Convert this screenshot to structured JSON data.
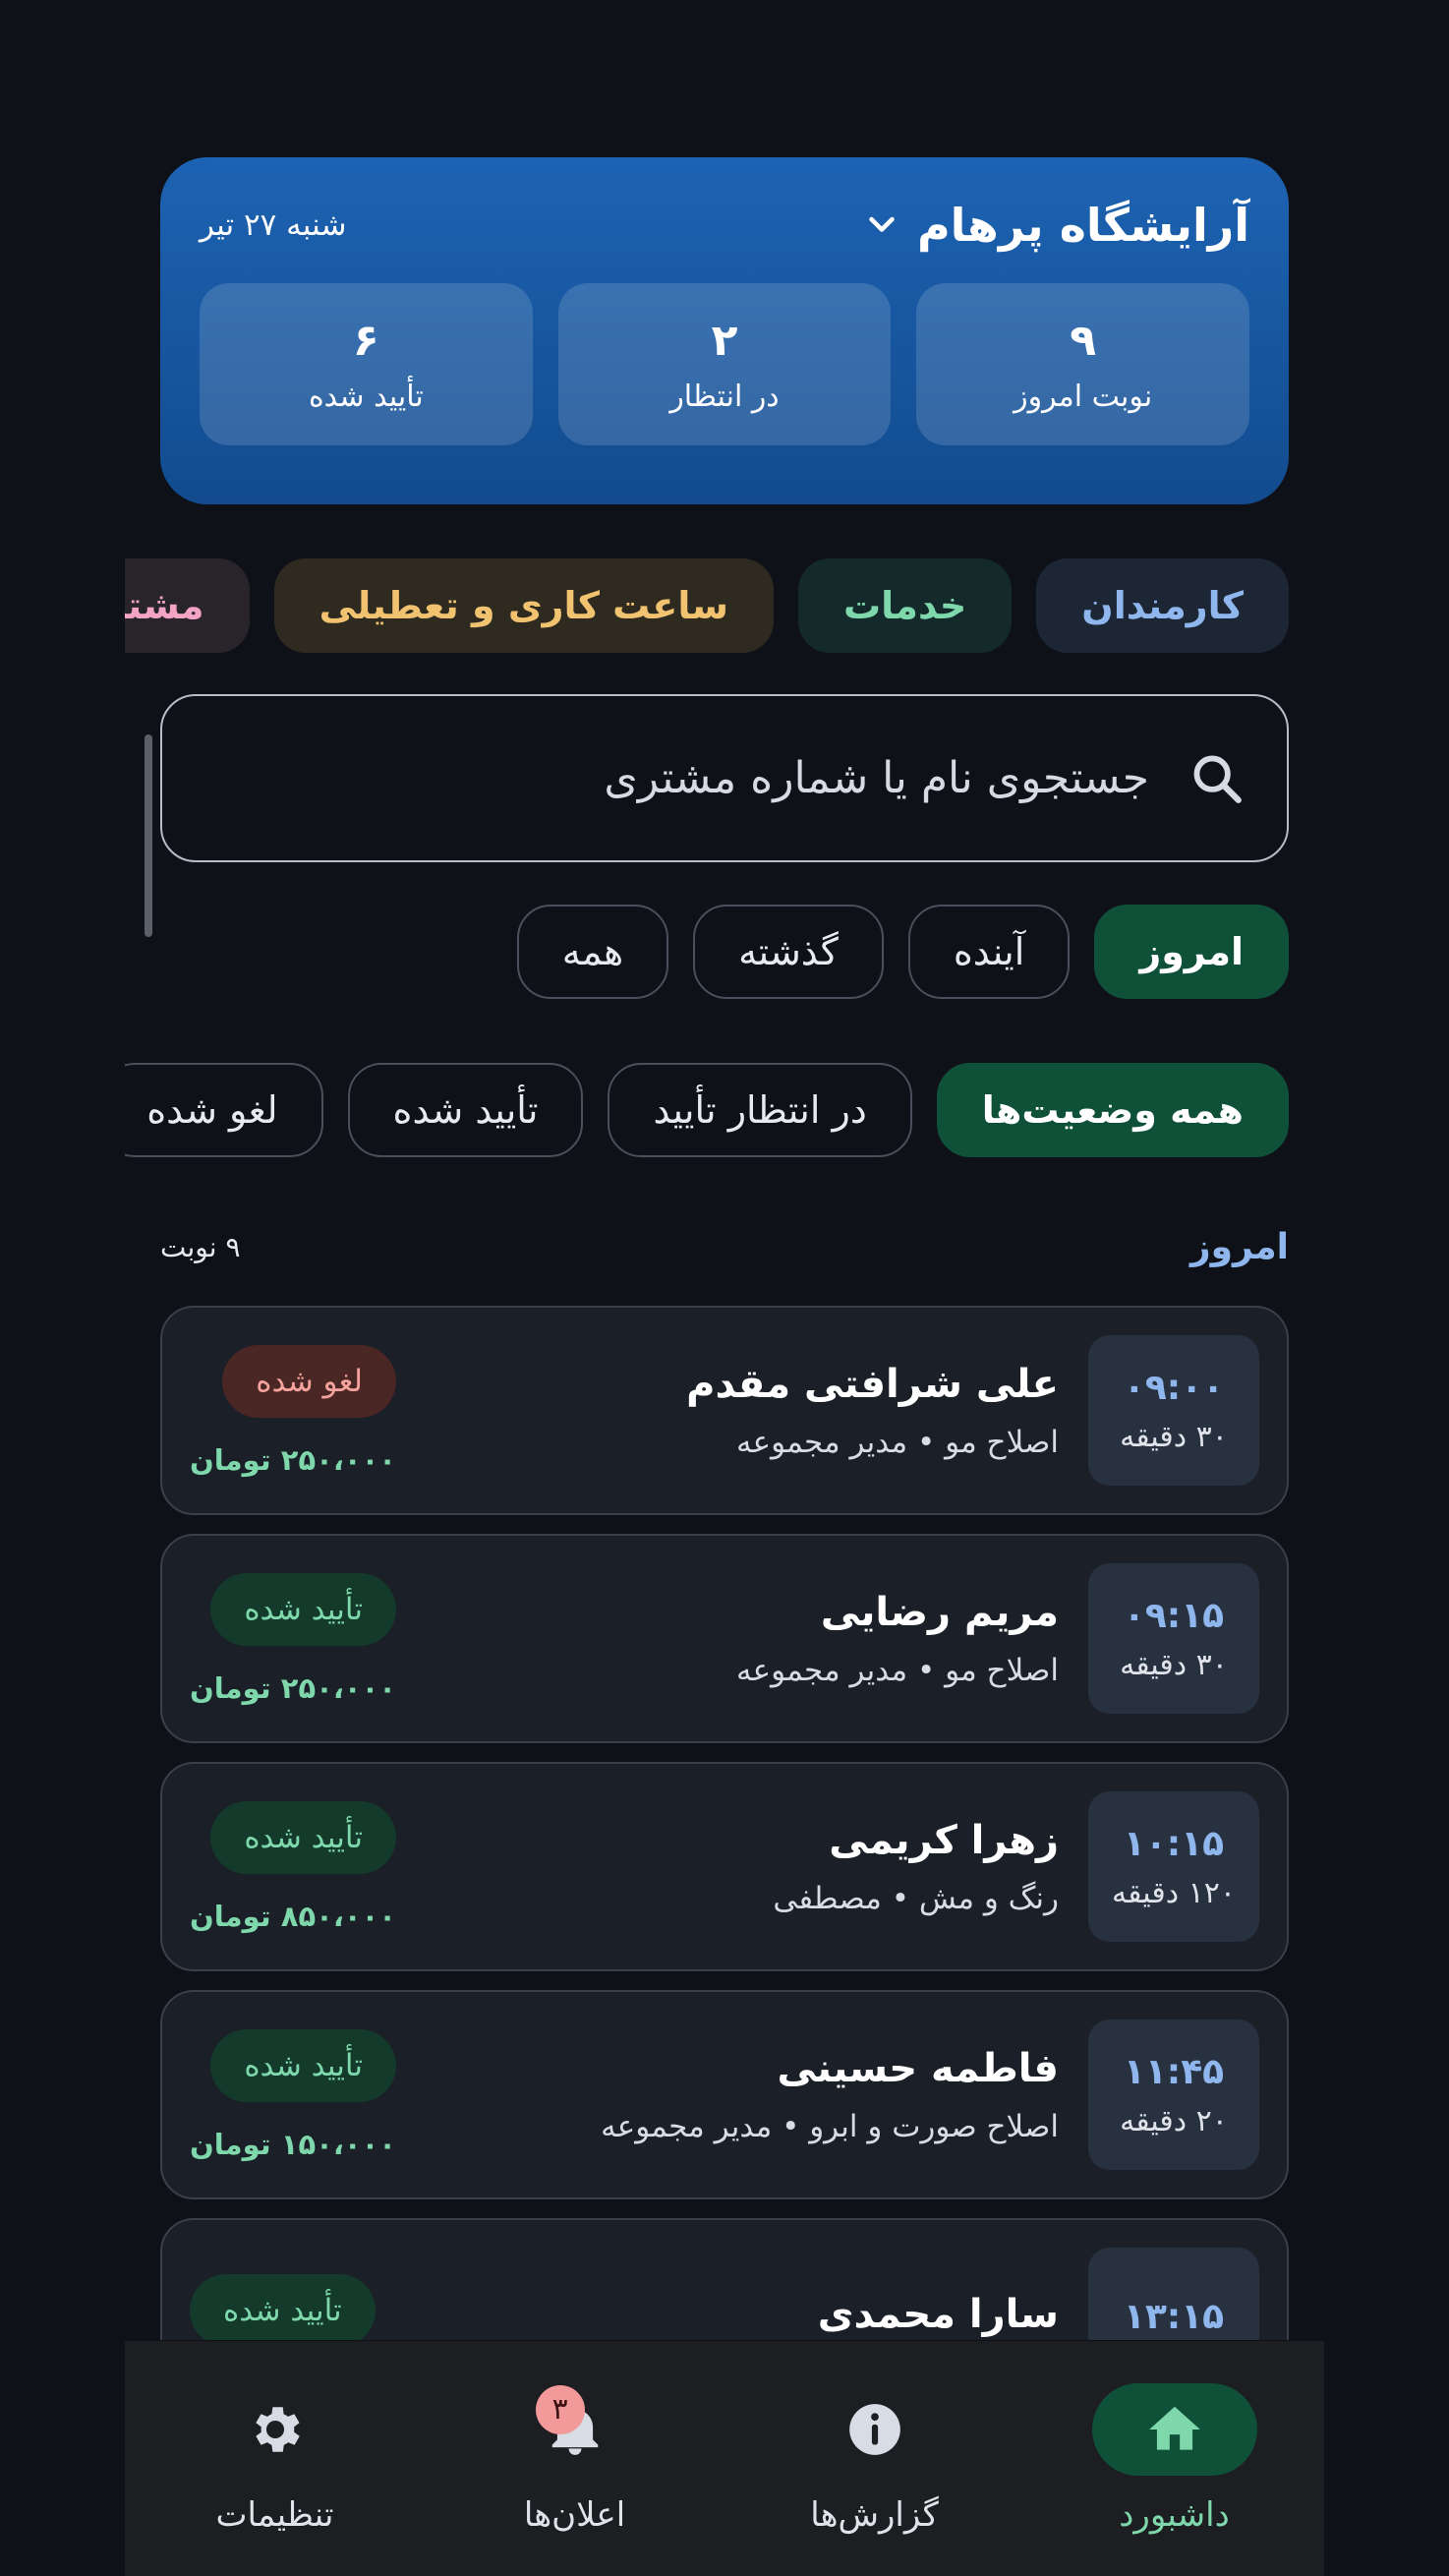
{
  "header": {
    "salon_name": "آرایشگاه پرهام",
    "date": "شنبه ۲۷ تیر",
    "stats": [
      {
        "value": "۹",
        "label": "نوبت امروز"
      },
      {
        "value": "۲",
        "label": "در انتظار"
      },
      {
        "value": "۶",
        "label": "تأیید شده"
      }
    ]
  },
  "quick_nav": [
    "کارمندان",
    "خدمات",
    "ساعت کاری و تعطیلی",
    "مشتریان"
  ],
  "search": {
    "placeholder": "جستجوی نام یا شماره مشتری",
    "value": ""
  },
  "date_filters": [
    "امروز",
    "آینده",
    "گذشته",
    "همه"
  ],
  "status_filters": [
    "همه وضعیت‌ها",
    "در انتظار تأیید",
    "تأیید شده",
    "لغو شده"
  ],
  "section": {
    "title": "امروز",
    "count": "۹ نوبت"
  },
  "appointments": [
    {
      "time": "۰۹:۰۰",
      "duration": "۳۰ دقیقه",
      "name": "علی شرافتی مقدم",
      "service": "اصلاح مو • مدیر مجموعه",
      "status": "لغو شده",
      "price": "۲۵۰،۰۰۰ تومان"
    },
    {
      "time": "۰۹:۱۵",
      "duration": "۳۰ دقیقه",
      "name": "مریم رضایی",
      "service": "اصلاح مو • مدیر مجموعه",
      "status": "تأیید شده",
      "price": "۲۵۰،۰۰۰ تومان"
    },
    {
      "time": "۱۰:۱۵",
      "duration": "۱۲۰ دقیقه",
      "name": "زهرا کریمی",
      "service": "رنگ و مش • مصطفی",
      "status": "تأیید شده",
      "price": "۸۵۰،۰۰۰ تومان"
    },
    {
      "time": "۱۱:۴۵",
      "duration": "۲۰ دقیقه",
      "name": "فاطمه حسینی",
      "service": "اصلاح صورت و ابرو • مدیر مجموعه",
      "status": "تأیید شده",
      "price": "۱۵۰،۰۰۰ تومان"
    },
    {
      "time": "۱۳:۱۵",
      "duration": "",
      "name": "سارا محمدی",
      "service": "",
      "status": "تأیید شده",
      "price": ""
    }
  ],
  "bottom_nav": [
    {
      "label": "داشبورد",
      "icon": "home-icon"
    },
    {
      "label": "گزارش‌ها",
      "icon": "info-icon"
    },
    {
      "label": "اعلان‌ها",
      "icon": "bell-icon",
      "badge": "۳"
    },
    {
      "label": "تنظیمات",
      "icon": "gear-icon"
    }
  ],
  "colors": {
    "accent_green": "#0f5138",
    "header_blue": "#1d63b3",
    "price_green": "#7ed8ac",
    "cancel_red": "#f5a39c"
  }
}
